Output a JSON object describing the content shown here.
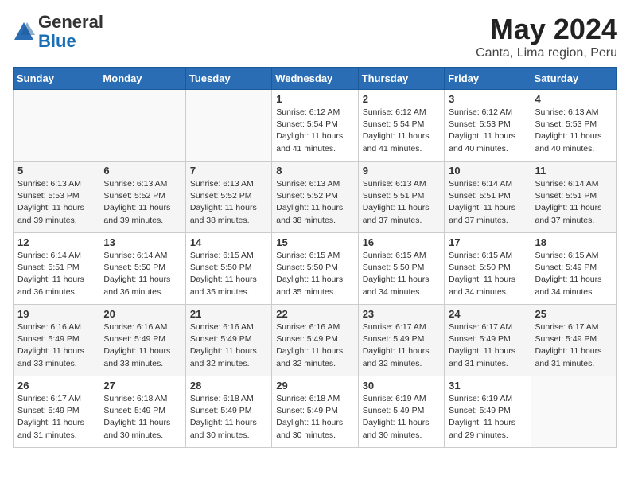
{
  "header": {
    "logo_general": "General",
    "logo_blue": "Blue",
    "month_title": "May 2024",
    "subtitle": "Canta, Lima region, Peru"
  },
  "days_of_week": [
    "Sunday",
    "Monday",
    "Tuesday",
    "Wednesday",
    "Thursday",
    "Friday",
    "Saturday"
  ],
  "weeks": [
    [
      {
        "day": "",
        "info": ""
      },
      {
        "day": "",
        "info": ""
      },
      {
        "day": "",
        "info": ""
      },
      {
        "day": "1",
        "info": "Sunrise: 6:12 AM\nSunset: 5:54 PM\nDaylight: 11 hours\nand 41 minutes."
      },
      {
        "day": "2",
        "info": "Sunrise: 6:12 AM\nSunset: 5:54 PM\nDaylight: 11 hours\nand 41 minutes."
      },
      {
        "day": "3",
        "info": "Sunrise: 6:12 AM\nSunset: 5:53 PM\nDaylight: 11 hours\nand 40 minutes."
      },
      {
        "day": "4",
        "info": "Sunrise: 6:13 AM\nSunset: 5:53 PM\nDaylight: 11 hours\nand 40 minutes."
      }
    ],
    [
      {
        "day": "5",
        "info": "Sunrise: 6:13 AM\nSunset: 5:53 PM\nDaylight: 11 hours\nand 39 minutes."
      },
      {
        "day": "6",
        "info": "Sunrise: 6:13 AM\nSunset: 5:52 PM\nDaylight: 11 hours\nand 39 minutes."
      },
      {
        "day": "7",
        "info": "Sunrise: 6:13 AM\nSunset: 5:52 PM\nDaylight: 11 hours\nand 38 minutes."
      },
      {
        "day": "8",
        "info": "Sunrise: 6:13 AM\nSunset: 5:52 PM\nDaylight: 11 hours\nand 38 minutes."
      },
      {
        "day": "9",
        "info": "Sunrise: 6:13 AM\nSunset: 5:51 PM\nDaylight: 11 hours\nand 37 minutes."
      },
      {
        "day": "10",
        "info": "Sunrise: 6:14 AM\nSunset: 5:51 PM\nDaylight: 11 hours\nand 37 minutes."
      },
      {
        "day": "11",
        "info": "Sunrise: 6:14 AM\nSunset: 5:51 PM\nDaylight: 11 hours\nand 37 minutes."
      }
    ],
    [
      {
        "day": "12",
        "info": "Sunrise: 6:14 AM\nSunset: 5:51 PM\nDaylight: 11 hours\nand 36 minutes."
      },
      {
        "day": "13",
        "info": "Sunrise: 6:14 AM\nSunset: 5:50 PM\nDaylight: 11 hours\nand 36 minutes."
      },
      {
        "day": "14",
        "info": "Sunrise: 6:15 AM\nSunset: 5:50 PM\nDaylight: 11 hours\nand 35 minutes."
      },
      {
        "day": "15",
        "info": "Sunrise: 6:15 AM\nSunset: 5:50 PM\nDaylight: 11 hours\nand 35 minutes."
      },
      {
        "day": "16",
        "info": "Sunrise: 6:15 AM\nSunset: 5:50 PM\nDaylight: 11 hours\nand 34 minutes."
      },
      {
        "day": "17",
        "info": "Sunrise: 6:15 AM\nSunset: 5:50 PM\nDaylight: 11 hours\nand 34 minutes."
      },
      {
        "day": "18",
        "info": "Sunrise: 6:15 AM\nSunset: 5:49 PM\nDaylight: 11 hours\nand 34 minutes."
      }
    ],
    [
      {
        "day": "19",
        "info": "Sunrise: 6:16 AM\nSunset: 5:49 PM\nDaylight: 11 hours\nand 33 minutes."
      },
      {
        "day": "20",
        "info": "Sunrise: 6:16 AM\nSunset: 5:49 PM\nDaylight: 11 hours\nand 33 minutes."
      },
      {
        "day": "21",
        "info": "Sunrise: 6:16 AM\nSunset: 5:49 PM\nDaylight: 11 hours\nand 32 minutes."
      },
      {
        "day": "22",
        "info": "Sunrise: 6:16 AM\nSunset: 5:49 PM\nDaylight: 11 hours\nand 32 minutes."
      },
      {
        "day": "23",
        "info": "Sunrise: 6:17 AM\nSunset: 5:49 PM\nDaylight: 11 hours\nand 32 minutes."
      },
      {
        "day": "24",
        "info": "Sunrise: 6:17 AM\nSunset: 5:49 PM\nDaylight: 11 hours\nand 31 minutes."
      },
      {
        "day": "25",
        "info": "Sunrise: 6:17 AM\nSunset: 5:49 PM\nDaylight: 11 hours\nand 31 minutes."
      }
    ],
    [
      {
        "day": "26",
        "info": "Sunrise: 6:17 AM\nSunset: 5:49 PM\nDaylight: 11 hours\nand 31 minutes."
      },
      {
        "day": "27",
        "info": "Sunrise: 6:18 AM\nSunset: 5:49 PM\nDaylight: 11 hours\nand 30 minutes."
      },
      {
        "day": "28",
        "info": "Sunrise: 6:18 AM\nSunset: 5:49 PM\nDaylight: 11 hours\nand 30 minutes."
      },
      {
        "day": "29",
        "info": "Sunrise: 6:18 AM\nSunset: 5:49 PM\nDaylight: 11 hours\nand 30 minutes."
      },
      {
        "day": "30",
        "info": "Sunrise: 6:19 AM\nSunset: 5:49 PM\nDaylight: 11 hours\nand 30 minutes."
      },
      {
        "day": "31",
        "info": "Sunrise: 6:19 AM\nSunset: 5:49 PM\nDaylight: 11 hours\nand 29 minutes."
      },
      {
        "day": "",
        "info": ""
      }
    ]
  ]
}
